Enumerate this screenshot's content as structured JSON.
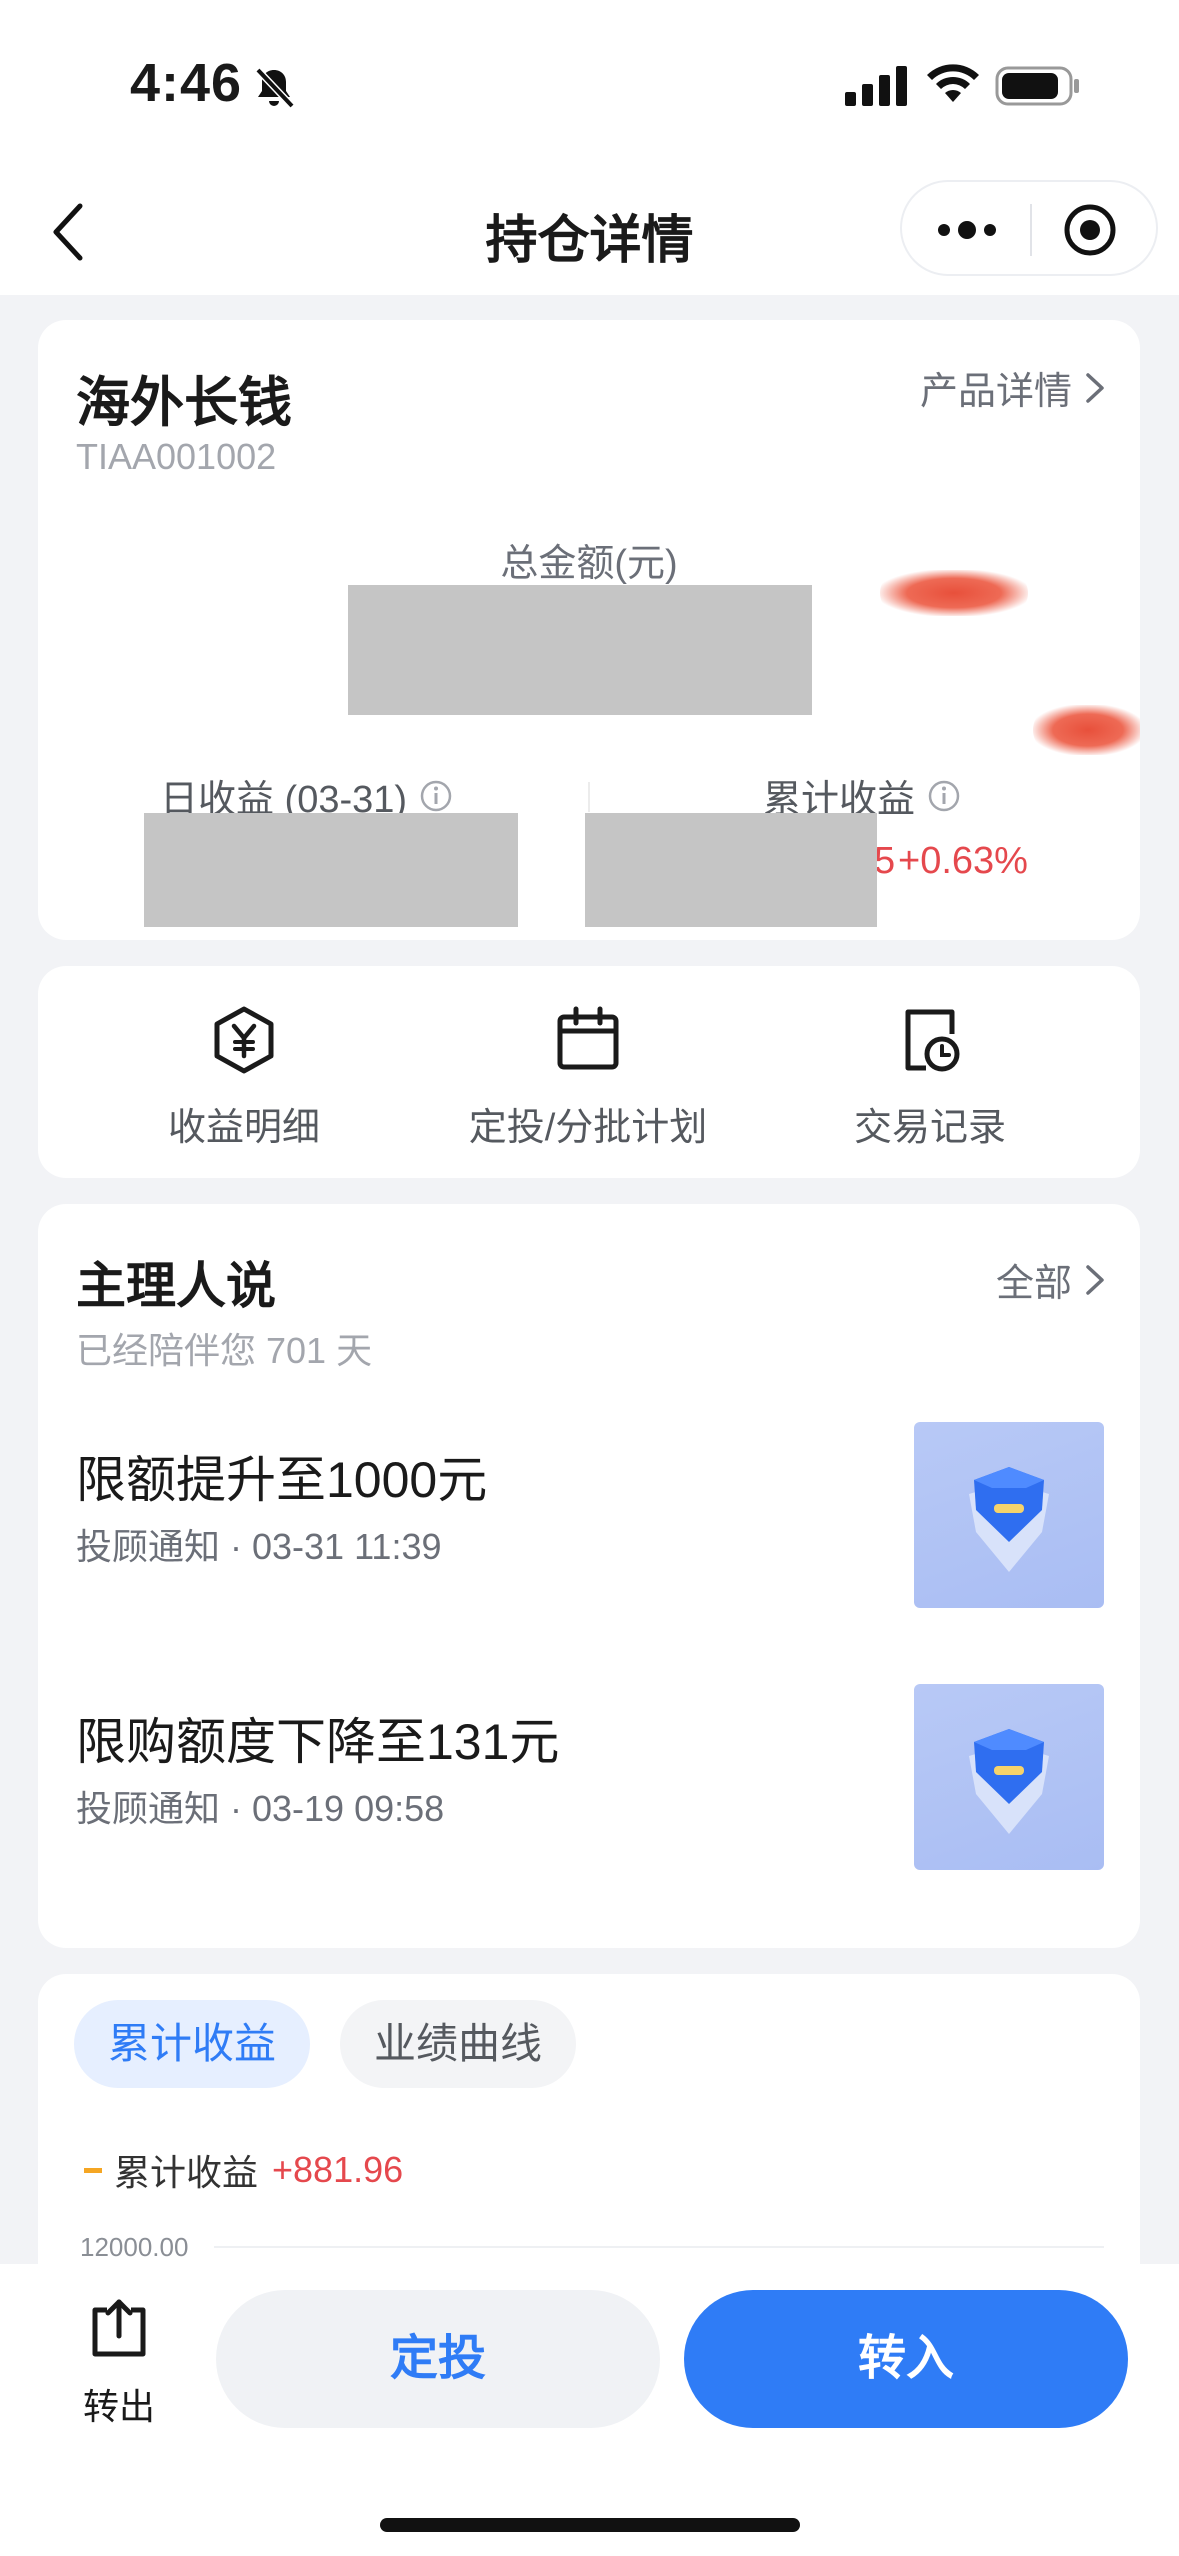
{
  "status": {
    "time": "4:46"
  },
  "nav": {
    "title": "持仓详情"
  },
  "product": {
    "name": "海外长钱",
    "code": "TIAA001002",
    "detail_link": "产品详情",
    "total_label": "总金额(元)",
    "daily_label": "日收益 (03-31)",
    "cumulative_label": "累计收益",
    "cumulative_fragment": "5",
    "cumulative_pct": "+0.63%"
  },
  "quick_actions": [
    {
      "label": "收益明细",
      "icon": "yuan-hexagon-icon"
    },
    {
      "label": "定投/分批计划",
      "icon": "calendar-icon"
    },
    {
      "label": "交易记录",
      "icon": "record-clock-icon"
    }
  ],
  "manager": {
    "title": "主理人说",
    "subtitle": "已经陪伴您 701 天",
    "all_link": "全部",
    "posts": [
      {
        "title": "限额提升至1000元",
        "meta": "投顾通知 · 03-31 11:39"
      },
      {
        "title": "限购额度下降至131元",
        "meta": "投顾通知 · 03-19 09:58"
      }
    ]
  },
  "chart_data": {
    "type": "line",
    "tabs": [
      "累计收益",
      "业绩曲线"
    ],
    "active_tab": "累计收益",
    "series": [
      {
        "name": "累计收益",
        "latest_value": "+881.96",
        "color": "#f5a623"
      }
    ],
    "y_ticks": [
      "12000.00"
    ]
  },
  "bottom": {
    "out_label": "转出",
    "dt_label": "定投",
    "in_label": "转入"
  },
  "colors": {
    "accent": "#2f7cf6",
    "positive": "#e5484d",
    "background": "#f2f3f6"
  }
}
